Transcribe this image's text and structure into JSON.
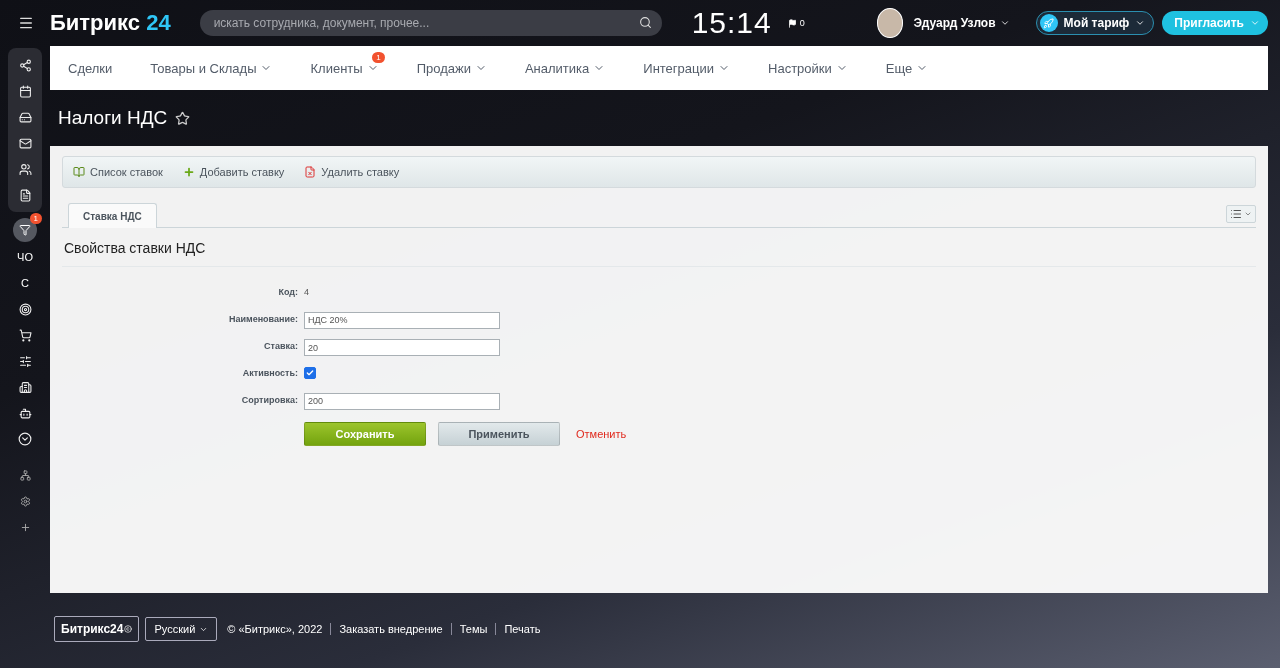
{
  "header": {
    "logo_main": "Битрикс",
    "logo_num": "24",
    "search": {
      "placeholder": "искать сотрудника, документ, прочее..."
    },
    "time": "15:14",
    "flag_count": "0",
    "user_name": "Эдуард Узлов",
    "tariff": "Мой тариф",
    "invite": "Пригласить"
  },
  "sidebar": {
    "badge": "1",
    "initials": [
      "ЧО",
      "С"
    ]
  },
  "nav": [
    {
      "label": "Сделки",
      "dropdown": false
    },
    {
      "label": "Товары и Склады",
      "dropdown": true
    },
    {
      "label": "Клиенты",
      "dropdown": true,
      "badge": "1"
    },
    {
      "label": "Продажи",
      "dropdown": true
    },
    {
      "label": "Аналитика",
      "dropdown": true
    },
    {
      "label": "Интеграции",
      "dropdown": true
    },
    {
      "label": "Настройки",
      "dropdown": true
    },
    {
      "label": "Еще",
      "dropdown": true
    }
  ],
  "page_title": "Налоги НДС",
  "toolbar": [
    {
      "kind": "list",
      "label": "Список ставок"
    },
    {
      "kind": "add",
      "label": "Добавить ставку"
    },
    {
      "kind": "delete",
      "label": "Удалить ставку"
    }
  ],
  "tabs": [
    {
      "label": "Ставка НДС",
      "selected": true
    }
  ],
  "section_title": "Свойства ставки НДС",
  "fields": [
    {
      "kind": "text",
      "label": "Код:",
      "value": "4"
    },
    {
      "kind": "input",
      "label": "Наименование:",
      "value": "НДС 20%"
    },
    {
      "kind": "input",
      "label": "Ставка:",
      "value": "20"
    },
    {
      "kind": "checkbox",
      "label": "Активность:",
      "checked": true
    },
    {
      "kind": "input",
      "label": "Сортировка:",
      "value": "200"
    }
  ],
  "buttons": [
    {
      "kind": "primary",
      "label": "Сохранить"
    },
    {
      "kind": "secondary",
      "label": "Применить"
    },
    {
      "kind": "link",
      "label": "Отменить"
    }
  ],
  "footer": {
    "logo": "Битрикс24",
    "language": "Русский",
    "copyright": "© «Битрикс», 2022",
    "links": [
      "Заказать внедрение",
      "Темы",
      "Печать"
    ]
  }
}
